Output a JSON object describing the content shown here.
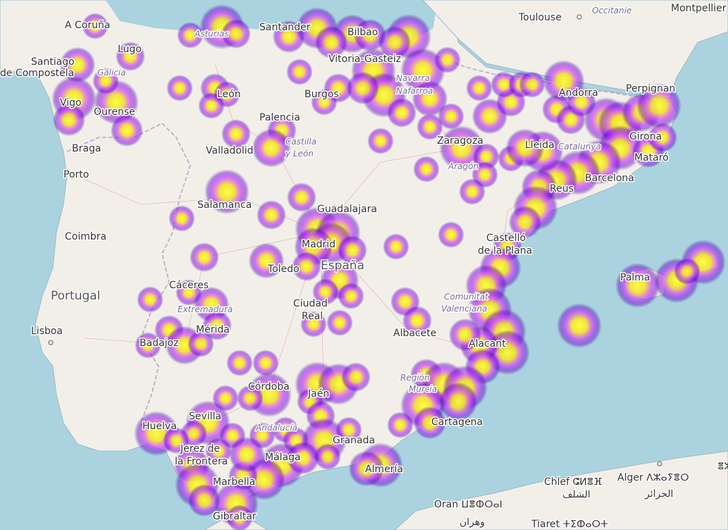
{
  "map": {
    "colors": {
      "sea": "#aad3df",
      "land": "#f2efe9",
      "heat_low": "#5b00c8",
      "heat_mid": "#d44cff",
      "heat_high": "#ffff33"
    },
    "labels": {
      "acoruna": "A Coruña",
      "lugo": "Lugo",
      "santiago1": "Santiago",
      "santiago2": "de Compostela",
      "galicia": "Galicia",
      "vigo": "Vigo",
      "ourense": "Ourense",
      "braga": "Braga",
      "porto": "Porto",
      "coimbra": "Coimbra",
      "portugal": "Portugal",
      "lisboa": "Lisboa",
      "santander": "Santander",
      "asturias": "Asturias",
      "bilbao": "Bilbao",
      "vitoria": "Vitoria-Gasteiz",
      "navarra": "Navarra",
      "nafarroa": "Nafarroa",
      "andorra": "Andorra",
      "toulouse": "Toulouse",
      "occitanie": "Occitanie",
      "montpellier": "Montpellier",
      "perpignan": "Perpignan",
      "leon": "León",
      "burgos": "Burgos",
      "palencia": "Palencia",
      "castilla1": "Castilla",
      "castilla2": "y León",
      "valladolid": "Valladolid",
      "zaragoza": "Zaragoza",
      "aragon": "Aragón",
      "lleida": "Lleida",
      "catalunya": "Catalunya",
      "girona": "Girona",
      "mataro": "Mataró",
      "barcelona": "Barcelona",
      "reus": "Reus",
      "salamanca": "Salamanca",
      "guadalajara": "Guadalajara",
      "madrid": "Madrid",
      "espana": "España",
      "toledo": "Toledo",
      "caceres": "Cáceres",
      "extremadura": "Extremadura",
      "merida": "Mérida",
      "badajoz": "Badajoz",
      "ciudadreal1": "Ciudad",
      "ciudadreal2": "Real",
      "albacete": "Albacete",
      "castellon1": "Castelló",
      "castellon2": "de la Plana",
      "comunitat1": "Comunitat",
      "comunitat2": "Valenciana",
      "alicante": "Alacant",
      "palma": "Palma",
      "cordoba": "Córdoba",
      "jaen": "Jaén",
      "region1": "Región",
      "region2": "Murcia",
      "sevilla": "Sevilla",
      "andalucia": "Andalucía",
      "granada": "Granada",
      "cartagena": "Cartagena",
      "huelva": "Huelva",
      "jerez1": "Jerez de",
      "jerez2": "la Frontera",
      "malaga": "Málaga",
      "marbella": "Marbella",
      "almeria": "Almería",
      "gibraltar": "Gibraltar",
      "chlef": "Chlef ⵛⵍⴻⴼ",
      "chlef_ar": "الشلف",
      "alger": "Alger ⴷⵣⴰⵢⴻⵔ",
      "alger_ar": "الجزائر",
      "oran": "Oran ⵡⴻⵀⵔⴰⵏ",
      "oran_ar": "وهران",
      "tiaret": "Tiaret ⵜⵉⵀⴰⵔⵜ",
      "edge": "ⴻⵣ"
    },
    "heat_blobs": [
      [
        135,
        37,
        0.4
      ],
      [
        110,
        92,
        0.7
      ],
      [
        105,
        140,
        1.0
      ],
      [
        98,
        170,
        0.6
      ],
      [
        165,
        145,
        1.0
      ],
      [
        180,
        185,
        0.6
      ],
      [
        185,
        80,
        0.5
      ],
      [
        150,
        115,
        0.4
      ],
      [
        270,
        50,
        0.4
      ],
      [
        315,
        38,
        1.0
      ],
      [
        335,
        48,
        0.5
      ],
      [
        410,
        52,
        0.6
      ],
      [
        450,
        40,
        0.9
      ],
      [
        500,
        48,
        0.8
      ],
      [
        525,
        50,
        0.6
      ],
      [
        580,
        52,
        1.0
      ],
      [
        560,
        60,
        0.6
      ],
      [
        470,
        60,
        0.6
      ],
      [
        530,
        100,
        1.0
      ],
      [
        545,
        135,
        1.0
      ],
      [
        600,
        100,
        1.0
      ],
      [
        610,
        140,
        0.7
      ],
      [
        480,
        125,
        0.5
      ],
      [
        460,
        145,
        0.4
      ],
      [
        515,
        125,
        0.6
      ],
      [
        570,
        160,
        0.5
      ],
      [
        635,
        85,
        0.4
      ],
      [
        425,
        102,
        0.4
      ],
      [
        255,
        125,
        0.4
      ],
      [
        305,
        125,
        0.5
      ],
      [
        322,
        134,
        0.4
      ],
      [
        300,
        150,
        0.4
      ],
      [
        400,
        185,
        0.5
      ],
      [
        335,
        190,
        0.5
      ],
      [
        385,
        210,
        0.8
      ],
      [
        540,
        200,
        0.4
      ],
      [
        610,
        180,
        0.4
      ],
      [
        640,
        165,
        0.4
      ],
      [
        695,
        165,
        0.7
      ],
      [
        725,
        145,
        0.5
      ],
      [
        680,
        125,
        0.4
      ],
      [
        715,
        120,
        0.4
      ],
      [
        740,
        120,
        0.4
      ],
      [
        755,
        120,
        0.4
      ],
      [
        655,
        210,
        1.0
      ],
      [
        690,
        222,
        0.4
      ],
      [
        725,
        225,
        0.4
      ],
      [
        605,
        240,
        0.4
      ],
      [
        688,
        248,
        0.4
      ],
      [
        670,
        272,
        0.4
      ],
      [
        800,
        115,
        0.9
      ],
      [
        790,
        155,
        0.5
      ],
      [
        810,
        170,
        0.5
      ],
      [
        825,
        145,
        0.5
      ],
      [
        860,
        170,
        1.0
      ],
      [
        880,
        175,
        1.0
      ],
      [
        880,
        210,
        1.0
      ],
      [
        850,
        230,
        1.0
      ],
      [
        820,
        245,
        1.0
      ],
      [
        790,
        255,
        0.9
      ],
      [
        770,
        215,
        0.9
      ],
      [
        745,
        210,
        0.8
      ],
      [
        910,
        160,
        0.8
      ],
      [
        935,
        150,
        1.0
      ],
      [
        920,
        215,
        0.6
      ],
      [
        940,
        195,
        0.5
      ],
      [
        765,
        265,
        0.7
      ],
      [
        760,
        295,
        1.0
      ],
      [
        745,
        315,
        0.6
      ],
      [
        322,
        272,
        1.0
      ],
      [
        428,
        280,
        0.5
      ],
      [
        385,
        305,
        0.5
      ],
      [
        258,
        310,
        0.4
      ],
      [
        290,
        365,
        0.5
      ],
      [
        378,
        370,
        0.7
      ],
      [
        450,
        325,
        1.0
      ],
      [
        480,
        330,
        1.0
      ],
      [
        470,
        345,
        0.9
      ],
      [
        445,
        350,
        0.8
      ],
      [
        500,
        355,
        0.5
      ],
      [
        435,
        378,
        0.5
      ],
      [
        482,
        398,
        0.8
      ],
      [
        462,
        414,
        0.4
      ],
      [
        498,
        420,
        0.4
      ],
      [
        640,
        333,
        0.4
      ],
      [
        562,
        350,
        0.4
      ],
      [
        720,
        350,
        0.5
      ],
      [
        710,
        380,
        0.9
      ],
      [
        690,
        405,
        0.9
      ],
      [
        695,
        440,
        1.0
      ],
      [
        715,
        470,
        1.0
      ],
      [
        720,
        500,
        1.0
      ],
      [
        680,
        490,
        0.8
      ],
      [
        660,
        475,
        0.6
      ],
      [
        685,
        520,
        0.7
      ],
      [
        213,
        425,
        0.4
      ],
      [
        268,
        415,
        0.4
      ],
      [
        300,
        432,
        0.7
      ],
      [
        308,
        462,
        0.5
      ],
      [
        240,
        468,
        0.5
      ],
      [
        262,
        490,
        0.8
      ],
      [
        210,
        490,
        0.4
      ],
      [
        285,
        488,
        0.4
      ],
      [
        445,
        460,
        0.4
      ],
      [
        482,
        458,
        0.4
      ],
      [
        575,
        428,
        0.5
      ],
      [
        592,
        455,
        0.5
      ],
      [
        340,
        515,
        0.4
      ],
      [
        377,
        515,
        0.4
      ],
      [
        382,
        560,
        1.0
      ],
      [
        355,
        565,
        0.4
      ],
      [
        320,
        565,
        0.4
      ],
      [
        450,
        545,
        1.0
      ],
      [
        480,
        545,
        0.9
      ],
      [
        505,
        535,
        0.5
      ],
      [
        440,
        570,
        0.4
      ],
      [
        455,
        590,
        0.5
      ],
      [
        605,
        532,
        0.6
      ],
      [
        630,
        545,
        1.0
      ],
      [
        660,
        550,
        1.0
      ],
      [
        650,
        570,
        0.8
      ],
      [
        600,
        575,
        1.0
      ],
      [
        610,
        600,
        0.6
      ],
      [
        568,
        603,
        0.4
      ],
      [
        295,
        600,
        1.0
      ],
      [
        275,
        615,
        0.4
      ],
      [
        222,
        615,
        1.0
      ],
      [
        250,
        625,
        0.4
      ],
      [
        330,
        618,
        0.4
      ],
      [
        372,
        618,
        0.4
      ],
      [
        405,
        610,
        0.4
      ],
      [
        420,
        625,
        0.4
      ],
      [
        460,
        625,
        1.0
      ],
      [
        495,
        610,
        0.4
      ],
      [
        400,
        660,
        1.0
      ],
      [
        375,
        680,
        0.9
      ],
      [
        345,
        675,
        0.5
      ],
      [
        350,
        645,
        0.7
      ],
      [
        310,
        640,
        0.4
      ],
      [
        430,
        650,
        0.6
      ],
      [
        465,
        648,
        0.4
      ],
      [
        540,
        660,
        1.0
      ],
      [
        520,
        665,
        0.7
      ],
      [
        272,
        660,
        0.7
      ],
      [
        280,
        688,
        1.0
      ],
      [
        290,
        710,
        0.6
      ],
      [
        335,
        715,
        1.0
      ],
      [
        340,
        735,
        0.4
      ],
      [
        905,
        405,
        1.0
      ],
      [
        960,
        398,
        1.0
      ],
      [
        998,
        372,
        1.0
      ],
      [
        975,
        385,
        0.4
      ],
      [
        822,
        462,
        1.0
      ]
    ]
  }
}
